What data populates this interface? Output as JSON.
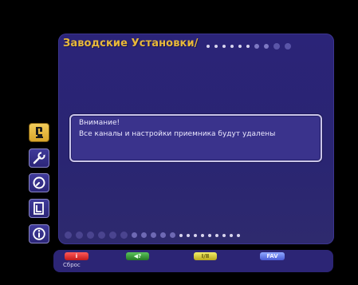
{
  "menu": {
    "title": "Заводские Установки/",
    "colors": {
      "title": "#e8b83a",
      "panel": "#2b2478",
      "active_icon": "#e8b83a"
    }
  },
  "dialog": {
    "title": "Внимание!",
    "message": "Все каналы и настройки приемника будут удалены"
  },
  "side_icons": [
    {
      "name": "satellite-dish-icon",
      "active": true
    },
    {
      "name": "wrench-icon",
      "active": false
    },
    {
      "name": "clock-icon",
      "active": false
    },
    {
      "name": "document-icon",
      "active": false
    },
    {
      "name": "info-icon",
      "active": false
    }
  ],
  "bottom_bar": {
    "red": {
      "label": "i",
      "caption": "Сброс"
    },
    "green": {
      "label": "◀?"
    },
    "yellow": {
      "label": "Ⅰ/Ⅱ"
    },
    "blue": {
      "label": "FAV"
    }
  }
}
